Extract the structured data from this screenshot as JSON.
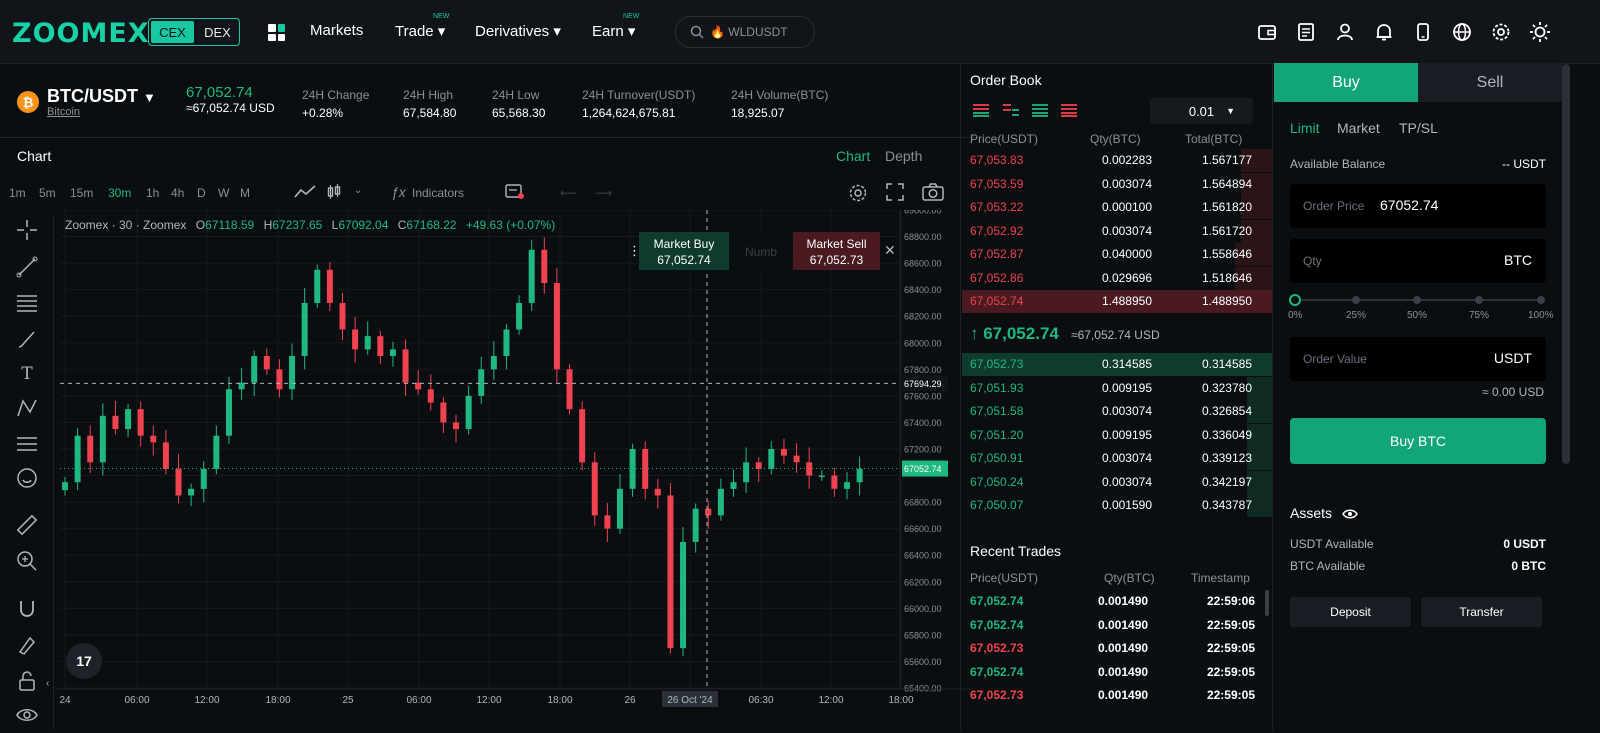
{
  "header": {
    "logo": "ZOOMEX",
    "cex": "CEX",
    "dex": "DEX",
    "nav": [
      {
        "label": "Markets",
        "new": ""
      },
      {
        "label": "Trade ▾",
        "new": "NEW"
      },
      {
        "label": "Derivatives ▾",
        "new": ""
      },
      {
        "label": "Earn ▾",
        "new": "NEW"
      }
    ],
    "search": "🔥 WLDUSDT",
    "icons": [
      "wallet-icon",
      "orders-icon",
      "user-icon",
      "bell-icon",
      "mobile-icon",
      "globe-icon",
      "gear-icon",
      "theme-icon"
    ]
  },
  "ticker": {
    "pair": "BTC/USDT",
    "pair_sub": "Bitcoin",
    "last": "67,052.74",
    "last_usd": "≈67,052.74 USD",
    "stats": [
      {
        "label": "24H Change",
        "value": "+0.28%"
      },
      {
        "label": "24H High",
        "value": "67,584.80"
      },
      {
        "label": "24H Low",
        "value": "65,568.30"
      },
      {
        "label": "24H Turnover(USDT)",
        "value": "1,264,624,675.81"
      },
      {
        "label": "24H Volume(BTC)",
        "value": "18,925.07"
      }
    ]
  },
  "chart": {
    "title": "Chart",
    "tab_chart": "Chart",
    "tab_depth": "Depth",
    "intervals": [
      "1m",
      "5m",
      "15m",
      "30m",
      "1h",
      "4h",
      "D",
      "W",
      "M"
    ],
    "active_interval": "30m",
    "indicators": "Indicators",
    "legend": {
      "source": "Zoomex · 30 · Zoomex",
      "o": "67118.59",
      "h": "67237.65",
      "l": "67092.04",
      "c": "67168.22",
      "chg": "+49.63 (+0.07%)"
    },
    "market_buy": "Market Buy",
    "market_buy_price": "67,052.74",
    "numb_placeholder": "Numb",
    "market_sell": "Market Sell",
    "market_sell_price": "67,052.73",
    "y_ticks": [
      "69000.00",
      "68800.00",
      "68600.00",
      "68400.00",
      "68200.00",
      "68000.00",
      "67800.00",
      "67694.29",
      "67600.00",
      "67400.00",
      "67200.00",
      "67052.74",
      "66800.00",
      "66600.00",
      "66400.00",
      "66200.00",
      "66000.00",
      "65800.00",
      "65600.00",
      "65400.00"
    ],
    "x_ticks": [
      "24",
      "06:00",
      "12:00",
      "18:00",
      "25",
      "06:00",
      "12:00",
      "18:00",
      "26",
      "26 Oct '24",
      "06:30",
      "12:00",
      "18:00"
    ],
    "crosshair_price": "67694.29",
    "current_price_label": "67052.74",
    "tv_logo": "17"
  },
  "chart_data": {
    "type": "candlestick",
    "interval": "30m",
    "ylim": [
      65400,
      69000
    ],
    "crosshair_price": 67694.29,
    "last_price": 67052.74,
    "close_trace": [
      66950,
      67300,
      67100,
      67450,
      67350,
      67500,
      67300,
      67250,
      67050,
      66850,
      66900,
      67050,
      67300,
      67650,
      67700,
      67900,
      67800,
      67650,
      67900,
      68300,
      68550,
      68300,
      68100,
      67950,
      68050,
      67900,
      67950,
      67700,
      67650,
      67550,
      67400,
      67350,
      67600,
      67800,
      67900,
      68100,
      68300,
      68700,
      68450,
      67800,
      67500,
      67100,
      66700,
      66600,
      66900,
      67200,
      66900,
      66850,
      65700,
      66500,
      66750,
      66700,
      66900,
      66950,
      67100,
      67050,
      67200,
      67150,
      67100,
      67000,
      67000,
      66900,
      66950,
      67050
    ]
  },
  "orderbook": {
    "title": "Order Book",
    "precision": "0.01",
    "headers": [
      "Price(USDT)",
      "Qty(BTC)",
      "Total(BTC)"
    ],
    "asks": [
      {
        "price": "67,053.83",
        "qty": "0.002283",
        "total": "1.567177",
        "depth": 0.1
      },
      {
        "price": "67,053.59",
        "qty": "0.003074",
        "total": "1.564894",
        "depth": 0.1
      },
      {
        "price": "67,053.22",
        "qty": "0.000100",
        "total": "1.561820",
        "depth": 0.1
      },
      {
        "price": "67,052.92",
        "qty": "0.003074",
        "total": "1.561720",
        "depth": 0.1
      },
      {
        "price": "67,052.87",
        "qty": "0.040000",
        "total": "1.558646",
        "depth": 0.12
      },
      {
        "price": "67,052.86",
        "qty": "0.029696",
        "total": "1.518646",
        "depth": 0.12
      },
      {
        "price": "67,052.74",
        "qty": "1.488950",
        "total": "1.488950",
        "depth": 1.0
      }
    ],
    "mid_price": "↑ 67,052.74",
    "mid_usd": "≈67,052.74 USD",
    "bids": [
      {
        "price": "67,052.73",
        "qty": "0.314585",
        "total": "0.314585",
        "depth": 1.0
      },
      {
        "price": "67,051.93",
        "qty": "0.009195",
        "total": "0.323780",
        "depth": 0.08
      },
      {
        "price": "67,051.58",
        "qty": "0.003074",
        "total": "0.326854",
        "depth": 0.08
      },
      {
        "price": "67,051.20",
        "qty": "0.009195",
        "total": "0.336049",
        "depth": 0.08
      },
      {
        "price": "67,050.91",
        "qty": "0.003074",
        "total": "0.339123",
        "depth": 0.08
      },
      {
        "price": "67,050.24",
        "qty": "0.003074",
        "total": "0.342197",
        "depth": 0.08
      },
      {
        "price": "67,050.07",
        "qty": "0.001590",
        "total": "0.343787",
        "depth": 0.08
      }
    ]
  },
  "recent_trades": {
    "title": "Recent Trades",
    "headers": [
      "Price(USDT)",
      "Qty(BTC)",
      "Timestamp"
    ],
    "rows": [
      {
        "price": "67,052.74",
        "qty": "0.001490",
        "time": "22:59:06",
        "side": "buy"
      },
      {
        "price": "67,052.74",
        "qty": "0.001490",
        "time": "22:59:05",
        "side": "buy"
      },
      {
        "price": "67,052.73",
        "qty": "0.001490",
        "time": "22:59:05",
        "side": "sell"
      },
      {
        "price": "67,052.74",
        "qty": "0.001490",
        "time": "22:59:05",
        "side": "buy"
      },
      {
        "price": "67,052.73",
        "qty": "0.001490",
        "time": "22:59:05",
        "side": "sell"
      }
    ]
  },
  "trade": {
    "buy_tab": "Buy",
    "sell_tab": "Sell",
    "order_tabs": [
      "Limit",
      "Market",
      "TP/SL"
    ],
    "available_label": "Available Balance",
    "available_value": "-- USDT",
    "order_price_label": "Order Price",
    "order_price": "67052.74",
    "qty_label": "Qty",
    "qty_unit": "BTC",
    "slider_marks": [
      "0%",
      "25%",
      "50%",
      "75%",
      "100%"
    ],
    "slider_value": 0,
    "order_value_label": "Order Value",
    "order_value_unit": "USDT",
    "approx": "≈ 0.00 USD",
    "buy_button": "Buy BTC",
    "assets_title": "Assets",
    "usdt_label": "USDT Available",
    "usdt_value": "0 USDT",
    "btc_label": "BTC Available",
    "btc_value": "0 BTC",
    "deposit": "Deposit",
    "transfer": "Transfer"
  },
  "colors": {
    "up": "#1fb881",
    "down": "#f0424f",
    "accent": "#12a57a",
    "logo": "#17d2a4"
  }
}
